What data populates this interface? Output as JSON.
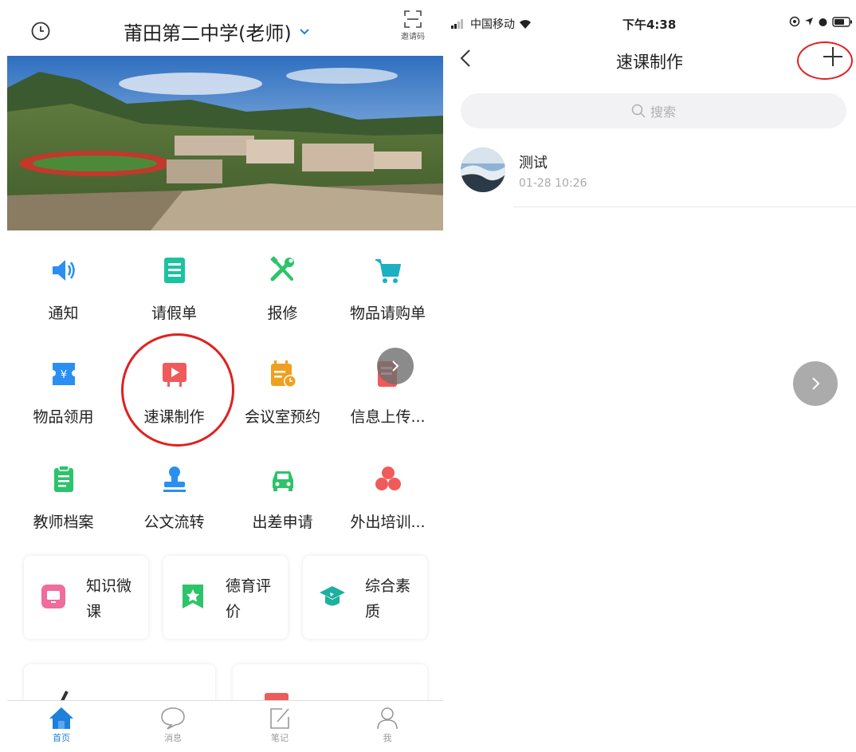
{
  "left": {
    "header": {
      "school_title": "莆田第二中学(老师)",
      "invite_label": "邀请码"
    },
    "grid": [
      {
        "label": "通知",
        "icon": "speaker-icon",
        "color": "#2a8ff0"
      },
      {
        "label": "请假单",
        "icon": "document-icon",
        "color": "#1cc3a0"
      },
      {
        "label": "报修",
        "icon": "tools-icon",
        "color": "#2dc36a"
      },
      {
        "label": "物品请购单",
        "icon": "cart-icon",
        "color": "#1cb0c0"
      },
      {
        "label": "物品领用",
        "icon": "ticket-icon",
        "color": "#2a8ff0"
      },
      {
        "label": "速课制作",
        "icon": "video-icon",
        "color": "#ef5a5a"
      },
      {
        "label": "会议室预约",
        "icon": "calendar-icon",
        "color": "#f0a020"
      },
      {
        "label": "信息上传...",
        "icon": "upload-doc-icon",
        "color": "#ef5a5a"
      },
      {
        "label": "教师档案",
        "icon": "clipboard-icon",
        "color": "#2dc36a"
      },
      {
        "label": "公文流转",
        "icon": "stamp-icon",
        "color": "#2a8ff0"
      },
      {
        "label": "出差申请",
        "icon": "car-icon",
        "color": "#2dc36a"
      },
      {
        "label": "外出培训...",
        "icon": "circles-icon",
        "color": "#ef5a5a"
      }
    ],
    "cards": [
      {
        "label": "知识微课",
        "icon": "tv-icon",
        "color": "#f06c9b"
      },
      {
        "label": "德育评价",
        "icon": "bookmark-star-icon",
        "color": "#2dc36a"
      },
      {
        "label": "综合素质",
        "icon": "graduation-cap-icon",
        "color": "#1cb0a0"
      }
    ],
    "tabbar": [
      {
        "label": "首页",
        "active": true
      },
      {
        "label": "消息",
        "active": false
      },
      {
        "label": "笔记",
        "active": false
      },
      {
        "label": "我",
        "active": false
      }
    ]
  },
  "right": {
    "status": {
      "carrier": "中国移动",
      "time": "下午4:38"
    },
    "nav": {
      "title": "速课制作"
    },
    "search": {
      "placeholder": "搜索"
    },
    "items": [
      {
        "title": "测试",
        "time": "01-28 10:26"
      }
    ]
  }
}
